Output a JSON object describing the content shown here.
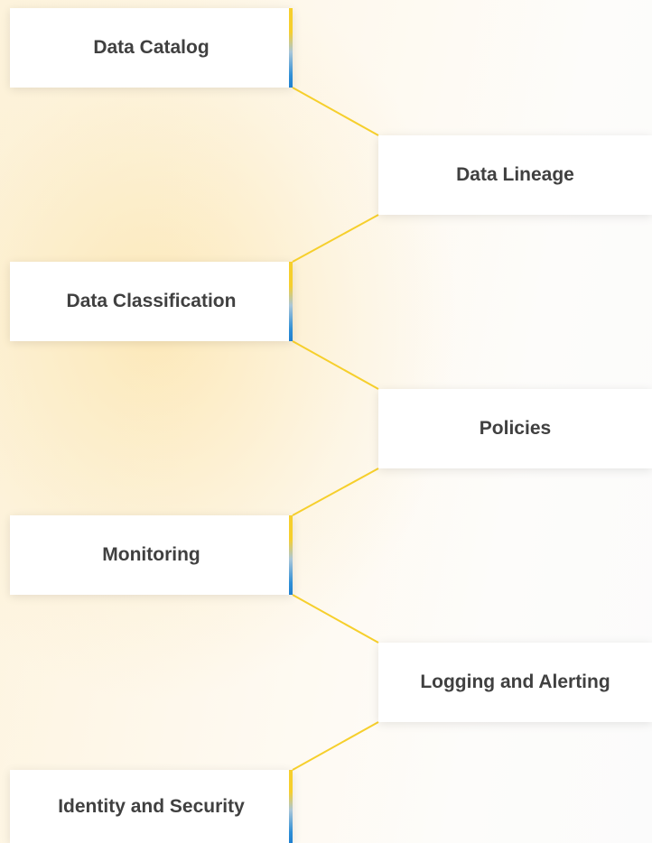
{
  "diagram": {
    "nodes": [
      {
        "label": "Data Catalog"
      },
      {
        "label": "Data Lineage"
      },
      {
        "label": "Data Classification"
      },
      {
        "label": "Policies"
      },
      {
        "label": "Monitoring"
      },
      {
        "label": "Logging and Alerting"
      },
      {
        "label": "Identity and Security"
      }
    ],
    "connector_color": "#f6cf2c"
  }
}
